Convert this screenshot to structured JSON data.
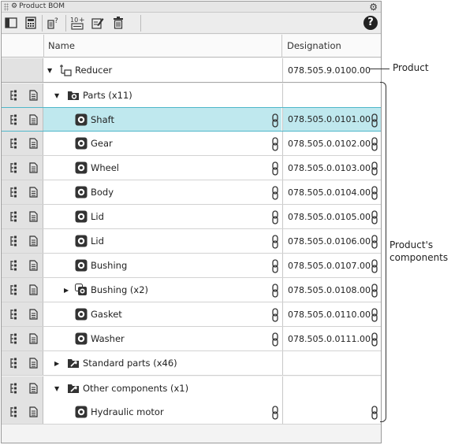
{
  "panel": {
    "title": "Product BOM"
  },
  "toolbar": {
    "buttons": [
      {
        "name": "panel-toggle-icon"
      },
      {
        "name": "calculator-icon"
      },
      {
        "name": "help-query-icon"
      },
      {
        "name": "numbering-icon",
        "label": "10"
      },
      {
        "name": "edit-icon"
      },
      {
        "name": "delete-icon"
      }
    ],
    "help_label": "?"
  },
  "columns": {
    "name": "Name",
    "designation": "Designation"
  },
  "rows": [
    {
      "level": 0,
      "type": "product",
      "expander": "expanded",
      "name": "Reducer",
      "designation": "078.505.9.0100.00",
      "links": false,
      "gutter": false,
      "selected": false
    },
    {
      "level": 1,
      "type": "folder",
      "expander": "expanded",
      "name": "Parts (x11)",
      "designation": "",
      "links": false,
      "gutter": true,
      "selected": false
    },
    {
      "level": 2,
      "type": "part",
      "expander": "none",
      "name": "Shaft",
      "designation": "078.505.0.0101.00",
      "links": true,
      "gutter": true,
      "selected": true
    },
    {
      "level": 2,
      "type": "part",
      "expander": "none",
      "name": "Gear",
      "designation": "078.505.0.0102.00",
      "links": true,
      "gutter": true,
      "selected": false
    },
    {
      "level": 2,
      "type": "part",
      "expander": "none",
      "name": "Wheel",
      "designation": "078.505.0.0103.00",
      "links": true,
      "gutter": true,
      "selected": false
    },
    {
      "level": 2,
      "type": "part",
      "expander": "none",
      "name": "Body",
      "designation": "078.505.0.0104.00",
      "links": true,
      "gutter": true,
      "selected": false
    },
    {
      "level": 2,
      "type": "part",
      "expander": "none",
      "name": "Lid",
      "designation": "078.505.0.0105.00",
      "links": true,
      "gutter": true,
      "selected": false
    },
    {
      "level": 2,
      "type": "part",
      "expander": "none",
      "name": "Lid",
      "designation": "078.505.0.0106.00",
      "links": true,
      "gutter": true,
      "selected": false
    },
    {
      "level": 2,
      "type": "part",
      "expander": "none",
      "name": "Bushing",
      "designation": "078.505.0.0107.00",
      "links": true,
      "gutter": true,
      "selected": false
    },
    {
      "level": 2,
      "type": "multipart",
      "expander": "collapsed",
      "name": "Bushing (x2)",
      "designation": "078.505.0.0108.00",
      "links": true,
      "gutter": true,
      "selected": false
    },
    {
      "level": 2,
      "type": "part",
      "expander": "none",
      "name": "Gasket",
      "designation": "078.505.0.0110.00",
      "links": true,
      "gutter": true,
      "selected": false
    },
    {
      "level": 2,
      "type": "part",
      "expander": "none",
      "name": "Washer",
      "designation": "078.505.0.0111.00",
      "links": true,
      "gutter": true,
      "selected": false
    },
    {
      "level": 1,
      "type": "folder-std",
      "expander": "collapsed",
      "name": "Standard parts (x46)",
      "designation": "",
      "links": false,
      "gutter": true,
      "selected": false
    },
    {
      "level": 1,
      "type": "folder-std",
      "expander": "expanded",
      "name": "Other components (x1)",
      "designation": "",
      "links": false,
      "gutter": true,
      "selected": false
    },
    {
      "level": 2,
      "type": "part",
      "expander": "none",
      "name": "Hydraulic motor",
      "designation": "",
      "links": true,
      "gutter": true,
      "selected": false
    }
  ],
  "annotations": {
    "product": "Product",
    "components_line1": "Product's",
    "components_line2": "components"
  }
}
